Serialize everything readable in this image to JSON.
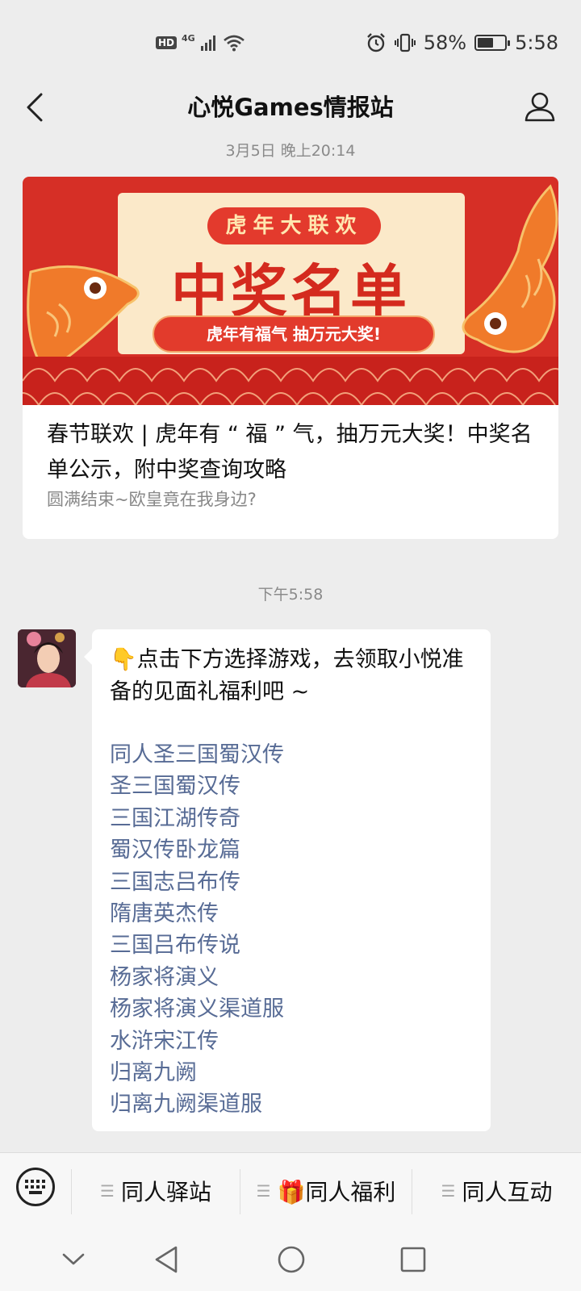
{
  "status_bar": {
    "hd": "HD",
    "network": "4G",
    "battery_text": "58%",
    "battery_level": 0.58,
    "time": "5:58"
  },
  "nav": {
    "title": "心悦Games情报站"
  },
  "timestamps": {
    "first": "3月5日 晚上20:14",
    "second": "下午5:58"
  },
  "article": {
    "banner_top": "虎年大联欢",
    "banner_main": "中奖名单",
    "banner_bottom": "虎年有福气  抽万元大奖!",
    "title": "春节联欢 | 虎年有 “ 福 ” 气，抽万元大奖！中奖名单公示，附中奖查询攻略",
    "subtitle": "圆满结束~欧皇竟在我身边?"
  },
  "message": {
    "intro": "👇点击下方选择游戏，去领取小悦准备的见面礼福利吧 ~",
    "games": [
      "同人圣三国蜀汉传",
      "圣三国蜀汉传",
      "三国江湖传奇",
      "蜀汉传卧龙篇",
      "三国志吕布传",
      "隋唐英杰传",
      "三国吕布传说",
      "杨家将演义",
      "杨家将演义渠道服",
      "水浒宋江传",
      "归离九阙",
      "归离九阙渠道服"
    ]
  },
  "menu": {
    "items": [
      {
        "label": "同人驿站",
        "icon": "menu-lines-icon"
      },
      {
        "label": "🎁同人福利",
        "icon": "menu-lines-icon"
      },
      {
        "label": "同人互动",
        "icon": "menu-lines-icon"
      }
    ]
  },
  "colors": {
    "link": "#576b95",
    "background": "#ededed",
    "banner_red": "#d62f26"
  }
}
